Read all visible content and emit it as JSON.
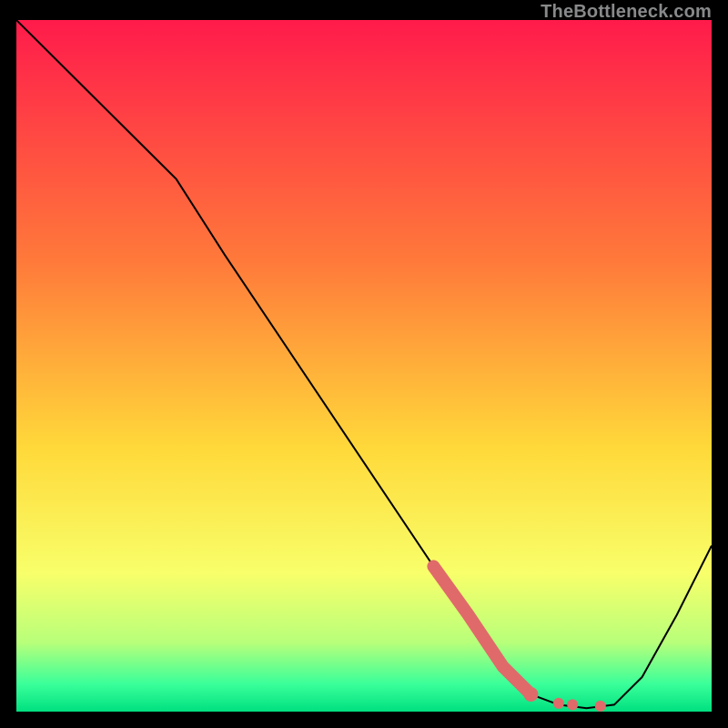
{
  "watermark": "TheBottleneck.com",
  "colors": {
    "gradient_top": "#ff1b4b",
    "gradient_mid1": "#ff7a3a",
    "gradient_mid2": "#ffd93a",
    "gradient_mid3": "#f8ff6a",
    "gradient_low1": "#b8ff7a",
    "gradient_low2": "#3aff9a",
    "gradient_bottom": "#00e080",
    "curve": "#000000",
    "highlight": "#e06a6a"
  },
  "chart_data": {
    "type": "line",
    "title": "",
    "xlabel": "",
    "ylabel": "",
    "xlim": [
      0,
      100
    ],
    "ylim": [
      0,
      100
    ],
    "grid": false,
    "series": [
      {
        "name": "bottleneck-curve",
        "x": [
          0,
          10,
          20,
          23,
          30,
          40,
          50,
          60,
          65,
          70,
          74,
          78,
          82,
          86,
          90,
          95,
          100
        ],
        "y": [
          100,
          90,
          80,
          77,
          66,
          51,
          36,
          21,
          14,
          6.5,
          2.5,
          1,
          0.5,
          1,
          5,
          14,
          24
        ]
      }
    ],
    "highlight_segment": {
      "name": "thick-red-segment",
      "x": [
        60,
        65,
        70,
        74
      ],
      "y": [
        21,
        14,
        6.5,
        2.5
      ]
    },
    "highlight_dots": {
      "name": "red-dots",
      "x": [
        74,
        78,
        80,
        84
      ],
      "y": [
        2.5,
        1.2,
        1.0,
        0.8
      ]
    }
  }
}
